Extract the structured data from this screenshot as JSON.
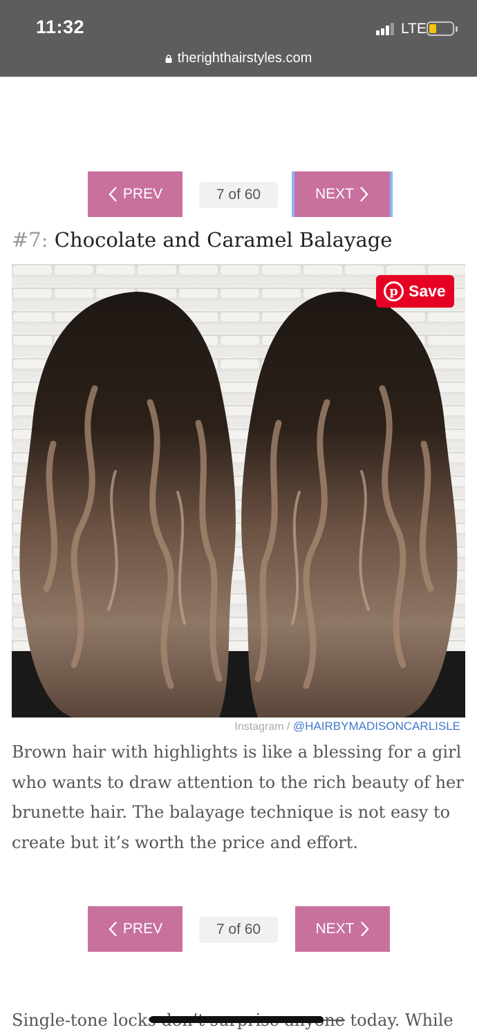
{
  "status_bar": {
    "time": "11:32",
    "network": "LTE"
  },
  "browser": {
    "url": "therighthairstyles.com"
  },
  "pager_top": {
    "prev_label": "PREV",
    "count_label": "7 of 60",
    "next_label": "NEXT"
  },
  "article": {
    "number": "#7:",
    "title": "Chocolate and Caramel Balayage",
    "pin_save_label": "Save",
    "credit_source": "Instagram /",
    "credit_handle": "@HAIRBYMADISONCARLISLE",
    "paragraph": "Brown hair with highlights is like a blessing for a girl who wants to draw attention to the rich beauty of her brunette hair. The balayage technique is not easy to create but it’s worth the price and effort.",
    "next_paragraph_start": "Single-tone locks",
    "next_paragraph_struck": "don’t surprise anyone",
    "next_paragraph_end": "today. While"
  },
  "pager_bottom": {
    "prev_label": "PREV",
    "count_label": "7 of 60",
    "next_label": "NEXT"
  },
  "colors": {
    "button_pink": "#c8719e",
    "pinterest_red": "#e60023",
    "credit_blue": "#3f78c9"
  }
}
